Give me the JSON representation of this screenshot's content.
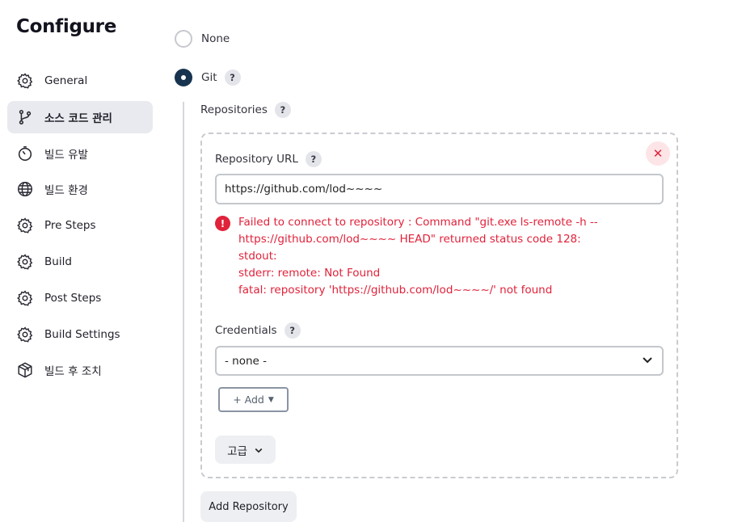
{
  "page_title": "Configure",
  "sidebar": {
    "items": [
      {
        "label": "General",
        "icon": "gear-icon"
      },
      {
        "label": "소스 코드 관리",
        "icon": "git-branch-icon",
        "active": true
      },
      {
        "label": "빌드 유발",
        "icon": "timer-icon"
      },
      {
        "label": "빌드 환경",
        "icon": "globe-icon"
      },
      {
        "label": "Pre Steps",
        "icon": "gear-icon"
      },
      {
        "label": "Build",
        "icon": "gear-icon"
      },
      {
        "label": "Post Steps",
        "icon": "gear-icon"
      },
      {
        "label": "Build Settings",
        "icon": "gear-icon"
      },
      {
        "label": "빌드 후 조치",
        "icon": "cube-icon"
      }
    ]
  },
  "scm": {
    "none_label": "None",
    "git_label": "Git",
    "selected": "Git",
    "help_glyph": "?",
    "repositories_label": "Repositories",
    "repository_url_label": "Repository URL",
    "repository_url_value": "https://github.com/lod~~~~",
    "error_lines": [
      "Failed to connect to repository : Command \"git.exe ls-remote -h --",
      "https://github.com/lod~~~~ HEAD\" returned status code 128:",
      "stdout:",
      "stderr: remote: Not Found",
      "fatal: repository 'https://github.com/lod~~~~/' not found"
    ],
    "credentials_label": "Credentials",
    "credentials_value": "- none -",
    "add_button": "+ Add",
    "advanced_button": "고급",
    "add_repository_button": "Add Repository"
  },
  "colors": {
    "error": "#e0223a",
    "radio_checked": "#17334f",
    "sidebar_active_bg": "#e9eaef"
  }
}
